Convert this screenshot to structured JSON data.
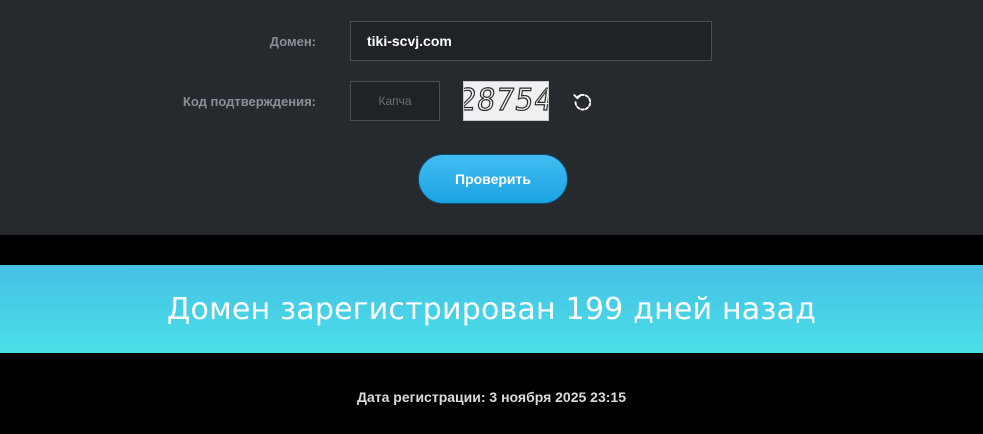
{
  "form": {
    "domain_label": "Домен:",
    "domain_value": "tiki-scvj.com",
    "captcha_label": "Код подтверждения:",
    "captcha_placeholder": "Капча",
    "captcha_code": "28754",
    "refresh_icon": "refresh-icon",
    "submit_label": "Проверить"
  },
  "result": {
    "headline": "Домен зарегистрирован 199 дней назад",
    "registration_date": "Дата регистрации: 3 ноября 2025 23:15"
  },
  "colors": {
    "panel_bg": "#26292d",
    "accent": "#1aa3e3",
    "banner_gradient_start": "#45c0e6",
    "banner_gradient_end": "#4adfe7"
  }
}
